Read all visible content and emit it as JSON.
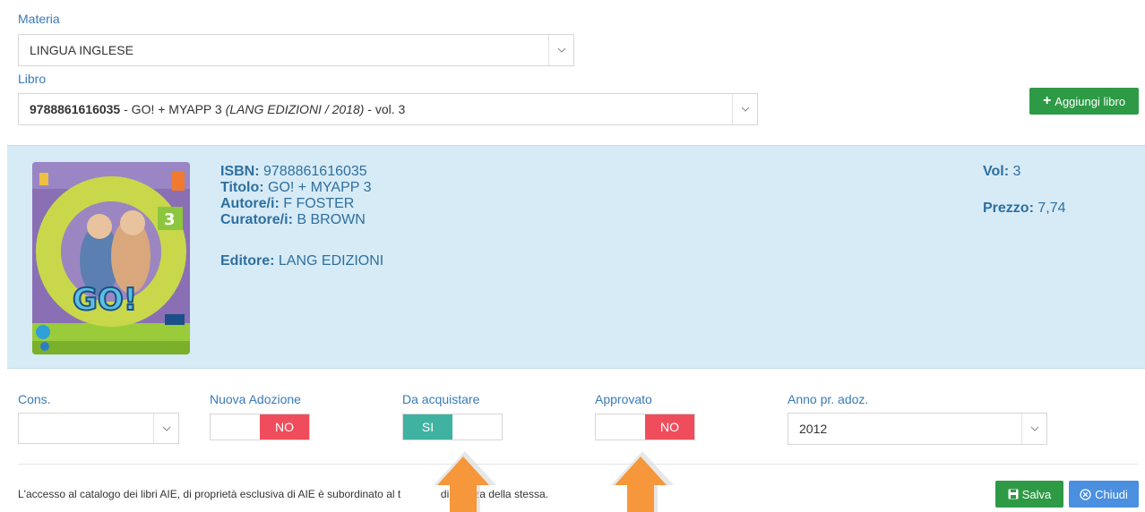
{
  "materia": {
    "label": "Materia",
    "value": "LINGUA INGLESE"
  },
  "libro": {
    "label": "Libro",
    "isbn": "9788861616035",
    "title_part": " - GO! + MYAPP 3 ",
    "publisher_year": "(LANG EDIZIONI / 2018)",
    "vol_part": " - vol. 3"
  },
  "add_book_button": "Aggiungi libro",
  "details": {
    "isbn_label": "ISBN:",
    "isbn_value": " 9788861616035",
    "titolo_label": "Titolo:",
    "titolo_value": " GO! + MYAPP 3",
    "autore_label": "Autore/i:",
    "autore_value": " F FOSTER",
    "curatore_label": "Curatore/i:",
    "curatore_value": " B BROWN",
    "editore_label": "Editore:",
    "editore_value": " LANG EDIZIONI",
    "vol_label": "Vol:",
    "vol_value": " 3",
    "prezzo_label": "Prezzo:",
    "prezzo_value": " 7,74"
  },
  "fields": {
    "cons": {
      "label": "Cons.",
      "value": ""
    },
    "nuova_adozione": {
      "label": "Nuova Adozione",
      "value": "NO"
    },
    "da_acquistare": {
      "label": "Da acquistare",
      "value": "SI"
    },
    "approvato": {
      "label": "Approvato",
      "value": "NO"
    },
    "anno": {
      "label": "Anno pr. adoz.",
      "value": "2012"
    }
  },
  "footer": {
    "text": "L'accesso al catalogo dei libri AIE, di proprietà esclusiva di AIE è subordinato al t",
    "text_tail": "di licenza della stessa.",
    "save_button": "Salva",
    "close_button": "Chiudi"
  },
  "colors": {
    "accent_green": "#2e9a46",
    "accent_blue": "#4a8fe0",
    "toggle_on_green": "#3fb2a1",
    "toggle_on_red": "#f04d5c",
    "panel_bg": "#d6ebf6",
    "label_blue": "#3a7ab8"
  }
}
